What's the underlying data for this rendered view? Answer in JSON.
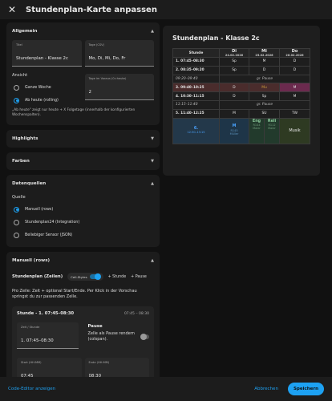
{
  "dialog": {
    "title": "Stundenplan-Karte anpassen"
  },
  "sections": {
    "general": {
      "title": "Allgemein",
      "title_field": {
        "label": "Titel",
        "value": "Stundenplan - Klasse 2c"
      },
      "days_field": {
        "label": "Tage (CSV)",
        "value": "Mo, Di, Mi, Do, Fr"
      },
      "view_label": "Ansicht",
      "view_options": [
        {
          "label": "Ganze Woche",
          "selected": false
        },
        {
          "label": "Ab heute (rolling)",
          "selected": true
        }
      ],
      "days_ahead_field": {
        "label": "Tage im Voraus (0=heute)",
        "value": "2"
      },
      "hint": "„Ab heute\" zeigt nur heute + X Folgetage (innerhalb der konfigurierten Wochenspalten)."
    },
    "highlights": {
      "title": "Highlights"
    },
    "colors": {
      "title": "Farben"
    },
    "datasources": {
      "title": "Datenquellen",
      "source_label": "Quelle",
      "options": [
        {
          "label": "Manuell (rows)",
          "selected": true
        },
        {
          "label": "Stundenplan24 (Integration)",
          "selected": false
        },
        {
          "label": "Beliebiger Sensor (JSON)",
          "selected": false
        }
      ]
    },
    "manual": {
      "title": "Manuell (rows)",
      "rows_heading": "Stundenplan (Zeilen)",
      "cell_styles_label": "Cell-Styles",
      "add_lesson_label": "+ Stunde",
      "add_pause_label": "+ Pause",
      "help_text": "Pro Zeile: Zeit + optional Start/Ende. Per Klick in der Vorschau springst du zur passenden Zelle.",
      "row_card": {
        "title": "Stunde - 1. 07:45–08:30",
        "time_range": "07:45 – 08:30",
        "time_field": {
          "label": "Zeit / Stunde",
          "value": "1. 07:45–08:30"
        },
        "pause_title": "Pause",
        "pause_text": "Zelle als Pause rendern (colspan).",
        "start_field": {
          "label": "Start (HH:MM)",
          "value": "07:45"
        },
        "end_field": {
          "label": "Ende (HH:MM)",
          "value": "08:30"
        }
      }
    }
  },
  "preview": {
    "title": "Stundenplan - Klasse 2c",
    "col_header": "Stunde",
    "days": [
      {
        "day": "Di",
        "date": "24.02.2026"
      },
      {
        "day": "Mi",
        "date": "25.02.2026"
      },
      {
        "day": "Do",
        "date": "26.02.2026"
      }
    ],
    "rows": [
      {
        "label": "1. 07:45–08:30",
        "cells": [
          "Sp",
          "M",
          "D"
        ]
      },
      {
        "label": "2. 08:35–09:20",
        "cells": [
          "Sp",
          "D",
          "D"
        ]
      },
      {
        "label": "09:20–09:40",
        "pause": "gr. Pause"
      },
      {
        "label": "3. 09:40–10:25",
        "cells": [
          "D",
          "Mu",
          "M"
        ]
      },
      {
        "label": "4. 10:30–11:15",
        "cells": [
          "D",
          "Sp",
          "M"
        ]
      },
      {
        "label": "11:15–11:40",
        "pause": "gr. Pause"
      },
      {
        "label": "5. 11:40–12:25",
        "cells": [
          "M",
          "SU",
          "TW"
        ]
      }
    ],
    "last_row": {
      "label": "6.",
      "time": "12:30–13:15",
      "cells": [
        {
          "subject": "M",
          "room": "R145",
          "teacher": "Müller"
        },
        {
          "subject": "Eng",
          "room": "R144",
          "teacher": "Maier"
        },
        {
          "subject": "Reli",
          "room": "R112",
          "teacher": "Maier"
        },
        {
          "subject": "Musik"
        }
      ]
    }
  },
  "footer": {
    "code_editor": "Code-Editor anzeigen",
    "cancel": "Abbrechen",
    "save": "Speichern"
  },
  "colors": {
    "accent": "#1da1f2",
    "current_row": "#4a2c2c",
    "highlight": "#6b2a4e",
    "music": "#c89a3a"
  }
}
